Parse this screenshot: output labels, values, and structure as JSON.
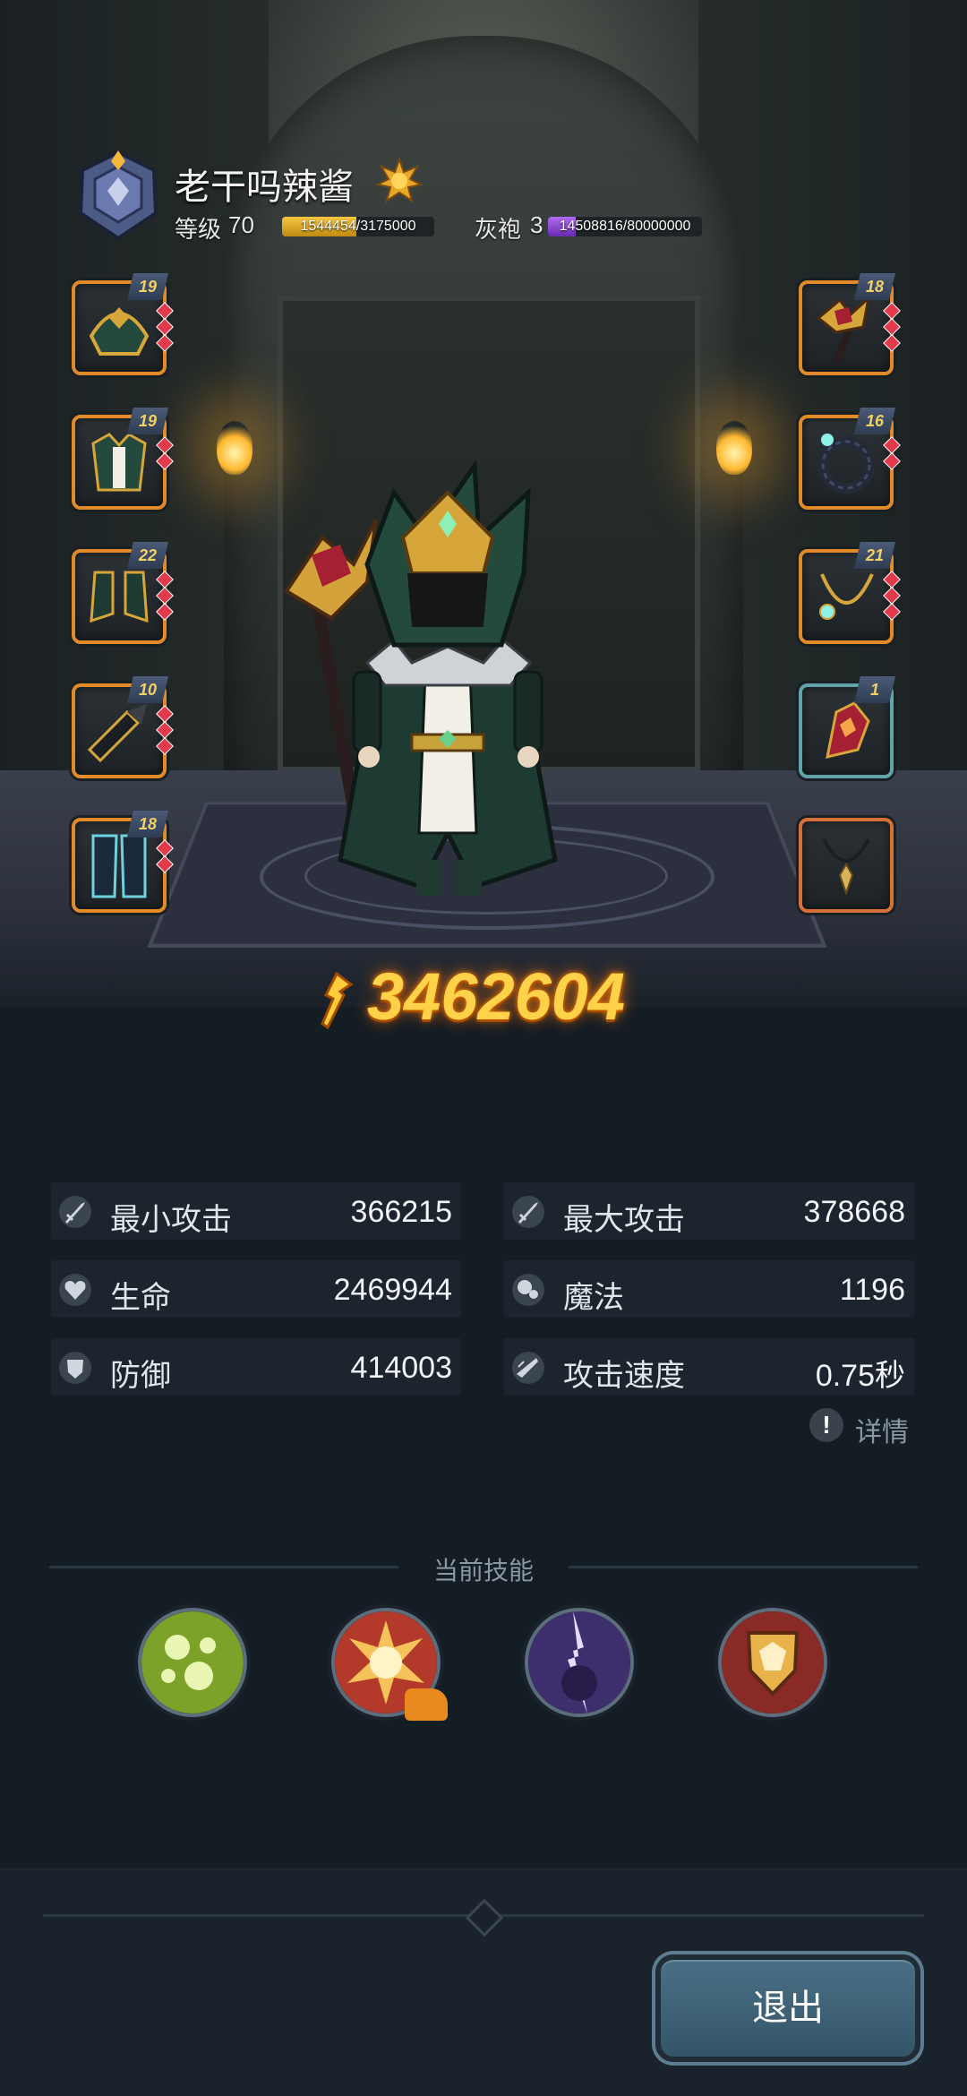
{
  "player": {
    "name": "老干吗辣酱",
    "level_label": "等级",
    "level": "70",
    "xp_text": "1544454/3175000",
    "xp_fraction": 0.486,
    "robe_label": "灰袍",
    "robe_level": "3",
    "robe_text": "14508816/80000000",
    "robe_fraction": 0.181
  },
  "equipment": {
    "left": [
      {
        "name": "helmet",
        "level": "19"
      },
      {
        "name": "armor",
        "level": "19"
      },
      {
        "name": "boots",
        "level": "22"
      },
      {
        "name": "gloves",
        "level": "10"
      },
      {
        "name": "pants",
        "level": "18"
      }
    ],
    "right": [
      {
        "name": "weapon",
        "level": "18"
      },
      {
        "name": "ring",
        "level": "16"
      },
      {
        "name": "necklace",
        "level": "21"
      },
      {
        "name": "offhand",
        "level": "1"
      },
      {
        "name": "amulet",
        "level": ""
      }
    ]
  },
  "power": "3462604",
  "stats": [
    {
      "label": "最小攻击",
      "value": "366215",
      "icon": "sword-icon"
    },
    {
      "label": "最大攻击",
      "value": "378668",
      "icon": "sword-icon"
    },
    {
      "label": "生命",
      "value": "2469944",
      "icon": "heart-icon"
    },
    {
      "label": "魔法",
      "value": "1196",
      "icon": "magic-icon"
    },
    {
      "label": "防御",
      "value": "414003",
      "icon": "shield-icon"
    },
    {
      "label": "攻击速度",
      "value": "0.75秒",
      "icon": "speed-icon"
    }
  ],
  "details_label": "详情",
  "skills": {
    "title": "当前技能",
    "items": [
      {
        "name": "poison-bubbles-skill-icon",
        "color": "#9cc23a"
      },
      {
        "name": "explosion-skill-icon",
        "color": "#f2b04a"
      },
      {
        "name": "lightning-skill-icon",
        "color": "#7b6ad4"
      },
      {
        "name": "shield-crest-skill-icon",
        "color": "#b5352d"
      }
    ]
  },
  "exit_label": "退出",
  "colors": {
    "accent_gold": "#ffd24a",
    "slot_orange": "#e08a2a",
    "background": "#141c24"
  }
}
